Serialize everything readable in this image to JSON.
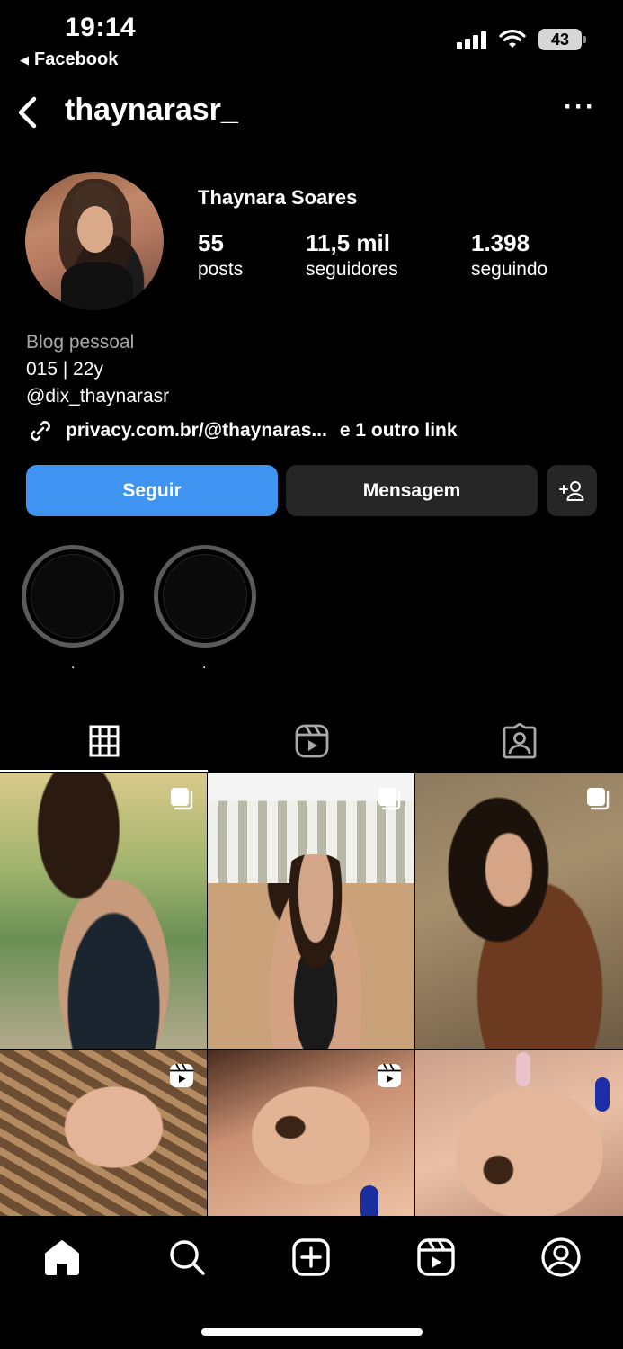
{
  "status_bar": {
    "time": "19:14",
    "back_app": "Facebook",
    "battery": "43"
  },
  "header": {
    "username": "thaynarasr_",
    "more": "···"
  },
  "profile": {
    "display_name": "Thaynara Soares",
    "stats": [
      {
        "value": "55",
        "label": "posts"
      },
      {
        "value": "11,5 mil",
        "label": "seguidores"
      },
      {
        "value": "1.398",
        "label": "seguindo"
      }
    ],
    "bio": {
      "category": "Blog pessoal",
      "line1": "015 | 22y",
      "line2": "@dix_thaynarasr"
    },
    "link": {
      "url": "privacy.com.br/@thaynaras...",
      "more": "e 1 outro link"
    }
  },
  "actions": {
    "follow": "Seguir",
    "message": "Mensagem"
  },
  "highlights": [
    {
      "label": "."
    },
    {
      "label": "."
    }
  ],
  "tabs": [
    "posts-grid",
    "reels",
    "tagged"
  ],
  "colors": {
    "background": "#000000",
    "follow_button": "#3f94f2",
    "secondary_button": "#262626",
    "muted_text": "#a8a8a8"
  },
  "bottom_nav": [
    "home-icon",
    "search-icon",
    "create-icon",
    "reels-icon",
    "profile-icon"
  ]
}
